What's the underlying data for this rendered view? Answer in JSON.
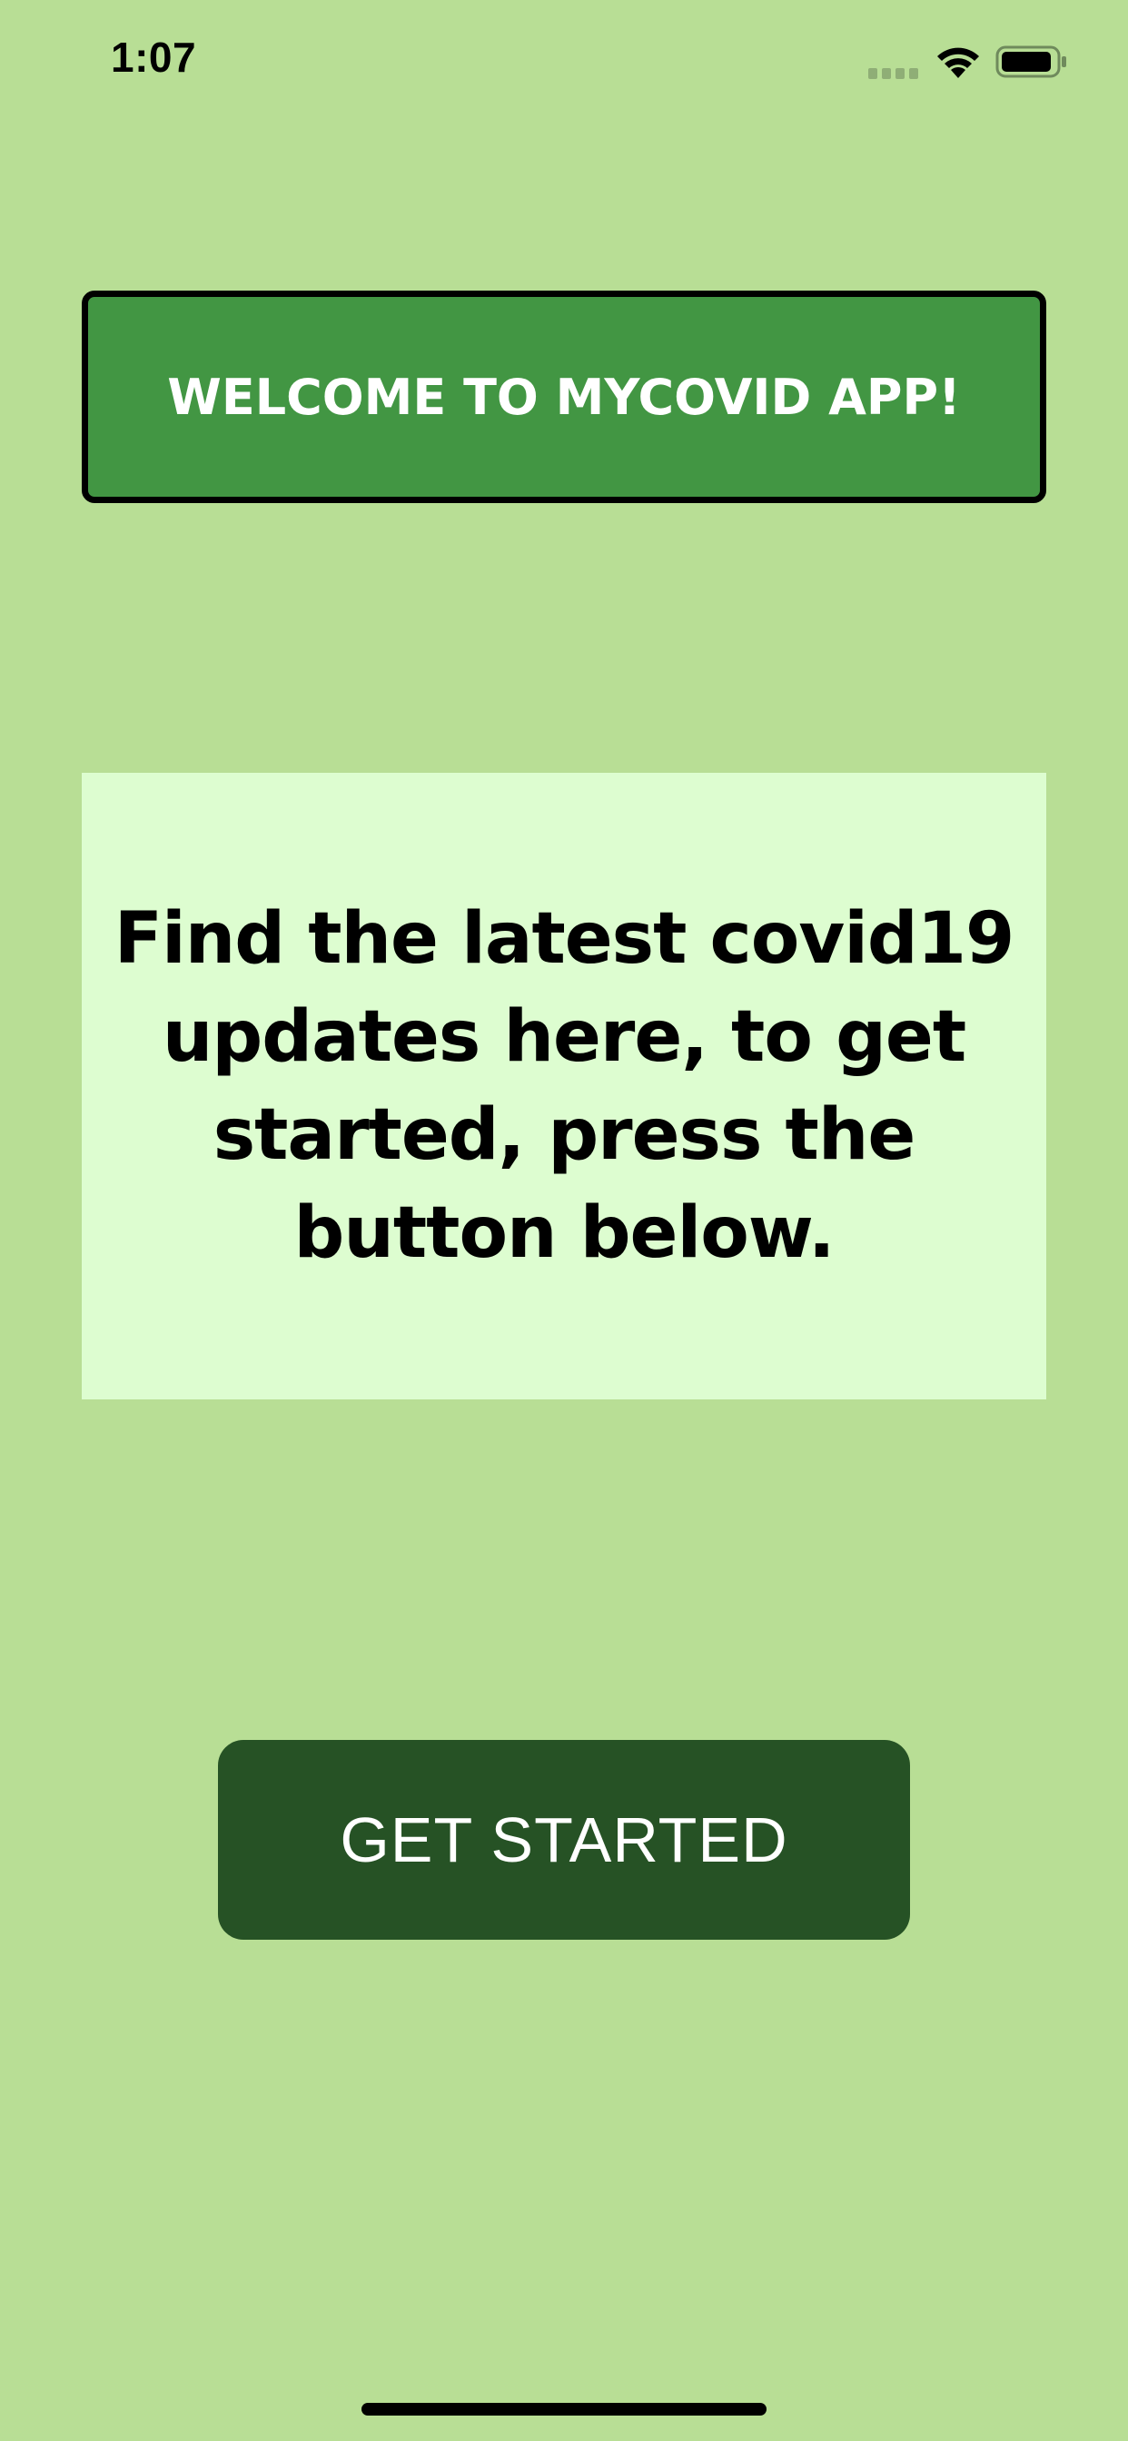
{
  "status_bar": {
    "time": "1:07",
    "signal_icon": "cellular-signal-icon",
    "wifi_icon": "wifi-icon",
    "battery_icon": "battery-icon"
  },
  "welcome": {
    "title": "WELCOME TO MYCOVID APP!"
  },
  "info": {
    "text": "Find the latest covid19 updates here, to get started, press the button below."
  },
  "actions": {
    "get_started_label": "GET STARTED"
  },
  "colors": {
    "background": "#b8de95",
    "banner": "#429643",
    "card": "#ddfdd0",
    "button": "#265225"
  }
}
